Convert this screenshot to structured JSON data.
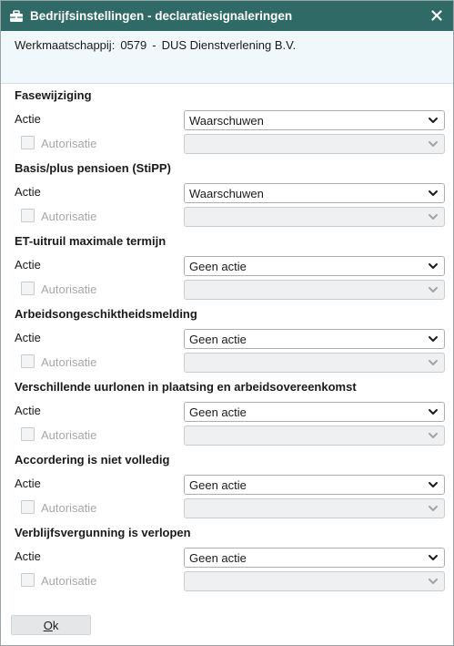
{
  "window": {
    "title": "Bedrijfsinstellingen - declaratiesignaleringen",
    "close_label": "✕"
  },
  "header": {
    "company_label": "Werkmaatschappij:",
    "company_number": "0579",
    "separator": "-",
    "company_name": "DUS Dienstverlening B.V."
  },
  "labels": {
    "actie": "Actie",
    "autorisatie": "Autorisatie"
  },
  "sections": [
    {
      "title": "Fasewijziging",
      "actie_value": "Waarschuwen",
      "autorisatie_checked": false,
      "autorisatie_value": ""
    },
    {
      "title": "Basis/plus pensioen (StiPP)",
      "actie_value": "Waarschuwen",
      "autorisatie_checked": false,
      "autorisatie_value": ""
    },
    {
      "title": "ET-uitruil maximale termijn",
      "actie_value": "Geen actie",
      "autorisatie_checked": false,
      "autorisatie_value": ""
    },
    {
      "title": "Arbeidsongeschiktheidsmelding",
      "actie_value": "Geen actie",
      "autorisatie_checked": false,
      "autorisatie_value": ""
    },
    {
      "title": "Verschillende uurlonen in plaatsing en arbeidsovereenkomst",
      "actie_value": "Geen actie",
      "autorisatie_checked": false,
      "autorisatie_value": ""
    },
    {
      "title": "Accordering is niet volledig",
      "actie_value": "Geen actie",
      "autorisatie_checked": false,
      "autorisatie_value": ""
    },
    {
      "title": "Verblijfsvergunning is verlopen",
      "actie_value": "Geen actie",
      "autorisatie_checked": false,
      "autorisatie_value": ""
    }
  ],
  "buttons": {
    "ok_accel": "O",
    "ok_rest": "k"
  },
  "icons": {
    "title_icon": "briefcase-icon",
    "close_icon": "close-icon",
    "dropdown_icon": "chevron-down-icon"
  },
  "colors": {
    "titlebar": "#2f6a66",
    "header_bg": "#f1f8fb"
  }
}
